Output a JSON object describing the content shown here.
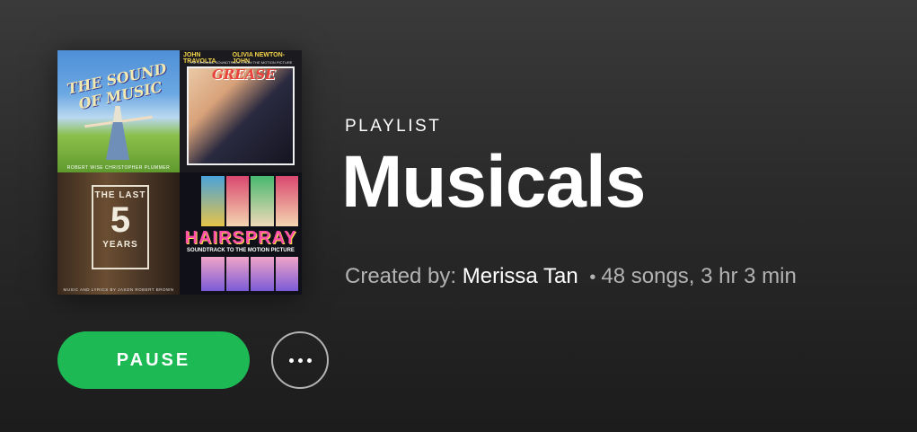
{
  "playlist": {
    "type_label": "PLAYLIST",
    "title": "Musicals",
    "created_by_label": "Created by:",
    "owner": "Merissa Tan",
    "separator": "•",
    "stats": "48 songs, 3 hr 3 min"
  },
  "cover": {
    "tiles": [
      {
        "title": "THE SOUND OF MUSIC",
        "credits": "ROBERT WISE CHRISTOPHER PLUMMER"
      },
      {
        "left_name": "JOHN TRAVOLTA",
        "right_name": "OLIVIA NEWTON-JOHN",
        "subtitle": "THE ORIGINAL SOUNDTRACK FROM THE MOTION PICTURE",
        "title": "GREASE"
      },
      {
        "line1": "THE LAST",
        "number": "5",
        "line2": "YEARS",
        "credits": "MUSIC AND LYRICS BY JASON ROBERT BROWN"
      },
      {
        "title": "HAIRSPRAY",
        "subtitle": "SOUNDTRACK TO THE MOTION PICTURE"
      }
    ]
  },
  "controls": {
    "pause_label": "PAUSE",
    "more_icon": "ellipsis-icon"
  },
  "colors": {
    "accent": "#1db954",
    "text_primary": "#ffffff",
    "text_secondary": "#b3b3b3"
  }
}
